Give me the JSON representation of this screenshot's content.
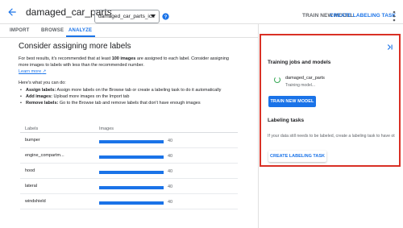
{
  "header": {
    "title": "damaged_car_parts",
    "dataset_select": "damaged_car_parts_icn",
    "train_new_model": "TRAIN NEW MODEL",
    "create_labeling_task": "CREATE LABELING TASK"
  },
  "tabs": [
    {
      "label": "IMPORT"
    },
    {
      "label": "BROWSE"
    },
    {
      "label": "ANALYZE"
    }
  ],
  "main": {
    "heading": "Consider assigning more labels",
    "para_prefix": "For best results, it's recommended that at least ",
    "para_bold": "100 images",
    "para_suffix": " are assigned to each label. Consider assigning more images to labels with less than the recommended number.",
    "learn_more": "Learn more",
    "you_can": "Here's what you can do:",
    "bullets": [
      {
        "bold": "Assign labels:",
        "text": " Assign more labels on the Browse tab or create a labeling task to do it automatically"
      },
      {
        "bold": "Add images:",
        "text": " Upload more images on the Import tab"
      },
      {
        "bold": "Remove labels:",
        "text": " Go to the Browse tab and remove labels that don't have enough images"
      }
    ]
  },
  "table": {
    "headers": [
      "Labels",
      "Images"
    ],
    "rows": [
      {
        "label": "bumper",
        "value": "40"
      },
      {
        "label": "engine_compartm...",
        "value": "40"
      },
      {
        "label": "hood",
        "value": "40"
      },
      {
        "label": "lateral",
        "value": "40"
      },
      {
        "label": "windshield",
        "value": "40"
      }
    ]
  },
  "panel": {
    "training_heading": "Training jobs and models",
    "job_name": "damaged_car_parts",
    "job_status": "Training model...",
    "train_button": "TRAIN NEW MODEL",
    "labeling_heading": "Labeling tasks",
    "labeling_text": "If your data still needs to be labeled, create a labeling task to have ot",
    "create_button": "CREATE LABELING TASK"
  },
  "colors": {
    "accent": "#1a73e8",
    "highlight_border": "#d93025",
    "spinner": "#34a853"
  }
}
